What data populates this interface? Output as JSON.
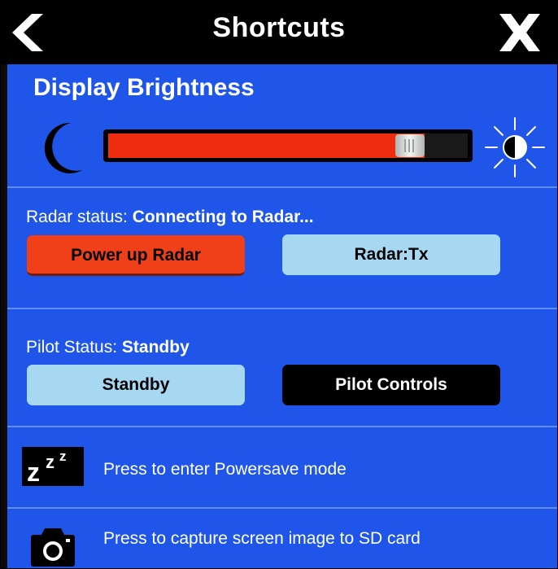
{
  "header": {
    "title": "Shortcuts",
    "back_icon": "chevron-left-icon",
    "close_icon": "close-icon"
  },
  "brightness": {
    "title": "Display Brightness",
    "level_percent": 88,
    "low_icon": "moon-icon",
    "high_icon": "sun-icon"
  },
  "radar": {
    "status_label": "Radar status:",
    "status_value": "Connecting to Radar...",
    "power_button": "Power up Radar",
    "tx_button": "Radar:Tx"
  },
  "pilot": {
    "status_label": "Pilot Status:",
    "status_value": "Standby",
    "standby_button": "Standby",
    "controls_button": "Pilot Controls"
  },
  "powersave": {
    "icon_text": "zzz",
    "label": "Press to enter Powersave mode"
  },
  "capture": {
    "icon": "camera-icon",
    "label": "Press to capture screen image to SD card"
  },
  "colors": {
    "background": "#1f56e9",
    "accent_red": "#ee2d10",
    "button_light": "#a6d8f2"
  }
}
